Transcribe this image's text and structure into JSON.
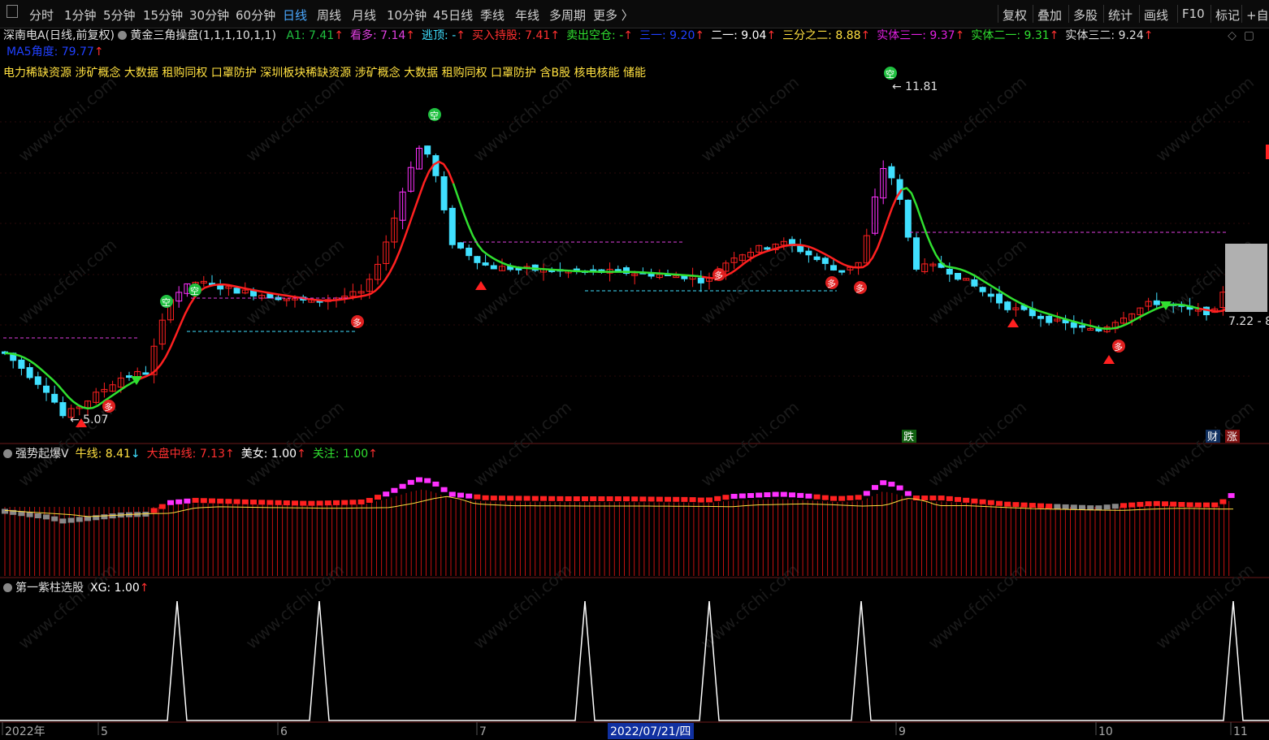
{
  "toolbar": {
    "items": [
      "分时",
      "1分钟",
      "5分钟",
      "15分钟",
      "30分钟",
      "60分钟",
      "日线",
      "周线",
      "月线",
      "10分钟",
      "45日线",
      "季线",
      "年线",
      "多周期",
      "更多"
    ],
    "active": "日线",
    "right_items": [
      "复权",
      "叠加",
      "多股",
      "统计",
      "画线",
      "F10",
      "标记",
      "+自"
    ]
  },
  "main_panel": {
    "stock_title": "深南电A(日线,前复权)",
    "indicator_name": "黄金三角操盘(1,1,1,10,1,1)",
    "values": [
      {
        "label": "A1: 7.41",
        "color": "#20c040"
      },
      {
        "label": "看多: 7.14",
        "color": "#e040e0"
      },
      {
        "label": "逃顶: -",
        "color": "#40e0ff"
      },
      {
        "label": "买入持股: 7.41",
        "color": "#ff3030"
      },
      {
        "label": "卖出空仓: -",
        "color": "#30e030"
      },
      {
        "label": "三一: 9.20",
        "color": "#2040ff"
      },
      {
        "label": "二一: 9.04",
        "color": "#ffffff"
      },
      {
        "label": "三分之二: 8.88",
        "color": "#ffe040"
      },
      {
        "label": "实体三一: 9.37",
        "color": "#e020e0"
      },
      {
        "label": "实体二一: 9.31",
        "color": "#30e030"
      },
      {
        "label": "实体三二: 9.24",
        "color": "#e0e0e0"
      }
    ],
    "ma5": "MA5角度: 79.77",
    "concepts": "电力稀缺资源 涉矿概念 大数据 租购同权 口罩防护 深圳板块稀缺资源 涉矿概念 大数据 租购同权 口罩防护 含B股 核电核能 储能",
    "high_label": "11.81",
    "low_label": "5.07",
    "right_label": "7.22 - 8",
    "signal_kong": "空",
    "signal_duo": "多",
    "badge_die": "跌",
    "badge_cai": "财",
    "badge_zhang": "涨"
  },
  "sub_panel_1": {
    "name": "强势起爆V",
    "values": [
      {
        "label": "牛线: 8.41",
        "color": "#ffe040",
        "arrow": "↓",
        "arrow_color": "#40e0ff"
      },
      {
        "label": "大盘中线: 7.13",
        "color": "#ff3030",
        "arrow": "↑",
        "arrow_color": "#ff3030"
      },
      {
        "label": "美女: 1.00",
        "color": "#ffffff",
        "arrow": "↑",
        "arrow_color": "#ff3030"
      },
      {
        "label": "关注: 1.00",
        "color": "#30e030",
        "arrow": "↑",
        "arrow_color": "#ff3030"
      }
    ]
  },
  "sub_panel_2": {
    "name": "第一紫柱选股",
    "values": [
      {
        "label": "XG: 1.00",
        "color": "#ffffff",
        "arrow": "↑",
        "arrow_color": "#ff3030"
      }
    ]
  },
  "time_axis": {
    "labels": [
      "2022年",
      "5",
      "6",
      "7",
      "9",
      "10",
      "11"
    ],
    "cursor_date": "2022/07/21/四"
  },
  "watermark": "www.cfchi.com",
  "colors": {
    "up": "#ff2020",
    "down": "#40e0ff",
    "bg": "#000000",
    "accent": "#4aa8ff"
  }
}
